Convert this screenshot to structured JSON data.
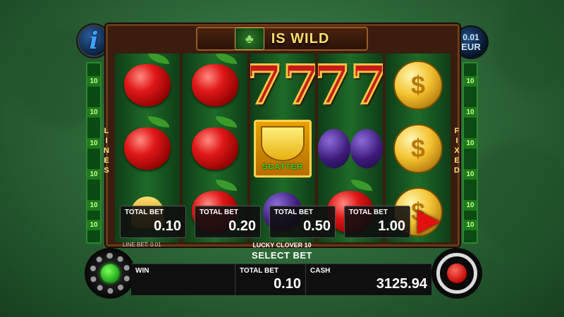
{
  "header": {
    "info_icon": "info-icon",
    "info_glyph": "i",
    "wild_icon": "clover-icon",
    "wild_badge_text": "WILD",
    "wild_text": "IS WILD"
  },
  "denomination": {
    "value": "0.01",
    "currency": "EUR"
  },
  "left_side": {
    "label": "LINES",
    "markers": [
      "10",
      "10",
      "10",
      "10",
      "10",
      "10",
      "10"
    ]
  },
  "right_side": {
    "label": "FIXED",
    "markers": [
      "10",
      "10",
      "10",
      "10",
      "10",
      "10",
      "10"
    ]
  },
  "reels": [
    [
      "apple",
      "apple",
      "apple-partial"
    ],
    [
      "apple",
      "apple",
      "apple-partial"
    ],
    [
      "seven",
      "banana-scatter",
      "plum-partial"
    ],
    [
      "seven",
      "plum",
      "apple-partial"
    ],
    [
      "coin",
      "coin",
      "coin-partial"
    ]
  ],
  "scatter_label": "SCATTER",
  "bet_options": [
    {
      "label": "TOTAL BET",
      "value": "0.10"
    },
    {
      "label": "TOTAL BET",
      "value": "0.20"
    },
    {
      "label": "TOTAL BET",
      "value": "0.50"
    },
    {
      "label": "TOTAL BET",
      "value": "1.00"
    }
  ],
  "next_bet_icon": "play-arrow-icon",
  "line_bet": "LINE BET: 0.01",
  "game_name": "LUCKY CLOVER 10",
  "select_bet": "SELECT BET",
  "status": {
    "win_label": "WIN",
    "win_value": "",
    "total_bet_label": "TOTAL BET",
    "total_bet_value": "0.10",
    "cash_label": "CASH",
    "cash_value": "3125.94"
  },
  "settings_icon": "gear-icon",
  "spin_icon": "autoplay-spin-icon",
  "colors": {
    "accent_green": "#1fa61a",
    "accent_red": "#e21010",
    "gold": "#ffdf6a"
  }
}
